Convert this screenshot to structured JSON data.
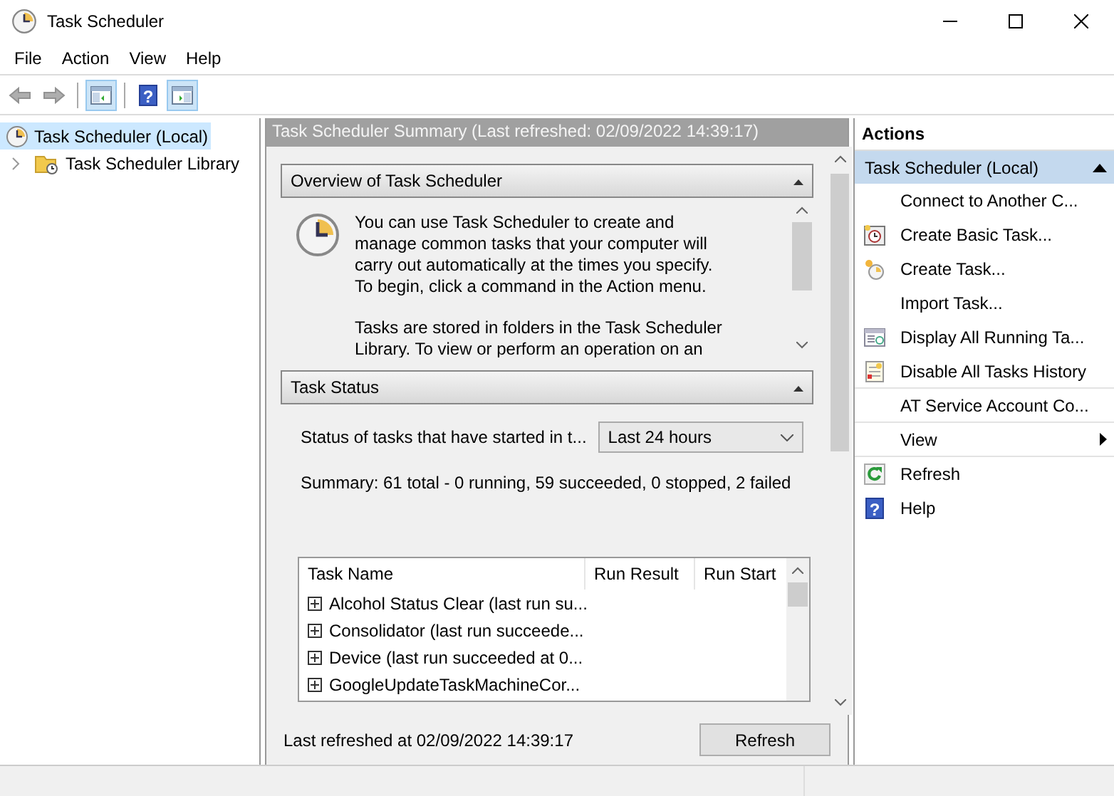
{
  "window": {
    "title": "Task Scheduler"
  },
  "menu": [
    "File",
    "Action",
    "View",
    "Help"
  ],
  "toolbar": [
    {
      "kind": "back",
      "selected": false,
      "disabled": true
    },
    {
      "kind": "forward",
      "selected": false,
      "disabled": true
    },
    {
      "kind": "console-tree",
      "selected": true,
      "disabled": false
    },
    {
      "kind": "help",
      "glyph": "?",
      "selected": false,
      "disabled": false
    },
    {
      "kind": "action-pane",
      "selected": true,
      "disabled": false
    }
  ],
  "tree": [
    {
      "label": "Task Scheduler (Local)",
      "kind": "clock",
      "selected": true,
      "children": [
        {
          "label": "Task Scheduler Library",
          "kind": "folder",
          "selected": false,
          "expanded": false
        }
      ]
    }
  ],
  "summary": {
    "header": "Task Scheduler Summary (Last refreshed: 02/09/2022 14:39:17)",
    "overview": {
      "title": "Overview of Task Scheduler",
      "paragraphs": [
        "You can use Task Scheduler to create and manage common tasks that your computer will carry out automatically at the times you specify. To begin, click a command in the Action menu.",
        "Tasks are stored in folders in the Task Scheduler Library. To view or perform an operation on an"
      ]
    },
    "task_status": {
      "title": "Task Status",
      "filter_label": "Status of tasks that have started in t...",
      "filter_value": "Last 24 hours",
      "summary": "Summary: 61 total - 0 running, 59 succeeded, 0 stopped, 2 failed",
      "table": {
        "columns": [
          "Task Name",
          "Run Result",
          "Run Start"
        ],
        "rows": [
          {
            "name": "Alcohol Status Clear (last run su...",
            "expanded": false
          },
          {
            "name": "Consolidator (last run succeede...",
            "expanded": false
          },
          {
            "name": "Device (last run succeeded at 0...",
            "expanded": false
          },
          {
            "name": "GoogleUpdateTaskMachineCor...",
            "expanded": false
          }
        ]
      }
    },
    "footer": "Last refreshed at 02/09/2022 14:39:17",
    "refresh_button": "Refresh"
  },
  "actions": {
    "title": "Actions",
    "group": {
      "label": "Task Scheduler (Local)",
      "expanded": true
    },
    "items": [
      {
        "label": "Connect to Another C...",
        "kind": "none",
        "submenu": false,
        "divider_below": false
      },
      {
        "label": "Create Basic Task...",
        "kind": "basic-task",
        "submenu": false,
        "divider_below": false
      },
      {
        "label": "Create Task...",
        "kind": "task",
        "submenu": false,
        "divider_below": false
      },
      {
        "label": "Import Task...",
        "kind": "none",
        "submenu": false,
        "divider_below": false
      },
      {
        "label": "Display All Running Ta...",
        "kind": "running",
        "submenu": false,
        "divider_below": false
      },
      {
        "label": "Disable All Tasks History",
        "kind": "history",
        "submenu": false,
        "divider_below": true
      },
      {
        "label": "AT Service Account Co...",
        "kind": "none",
        "submenu": false,
        "divider_below": true
      },
      {
        "label": "View",
        "kind": "none",
        "submenu": true,
        "divider_below": true
      },
      {
        "label": "Refresh",
        "kind": "refresh",
        "submenu": false,
        "divider_below": false
      },
      {
        "label": "Help",
        "kind": "help",
        "glyph": "?",
        "submenu": false,
        "divider_below": false
      }
    ]
  }
}
